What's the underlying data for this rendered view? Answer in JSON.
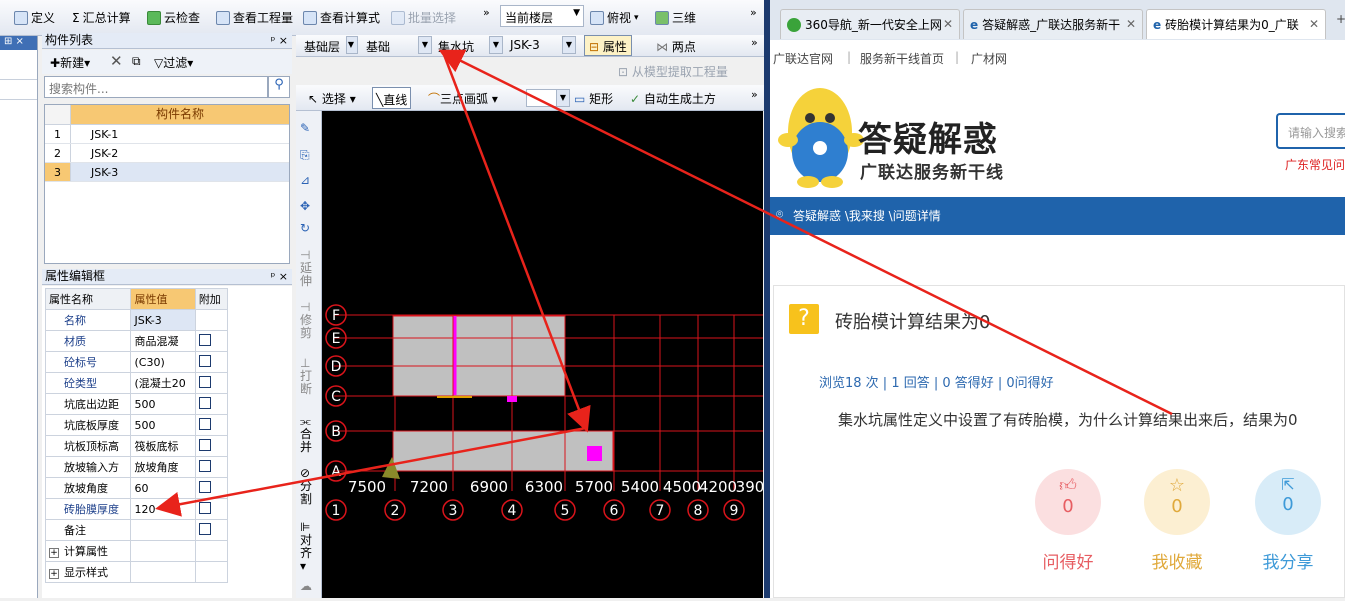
{
  "toolbar": {
    "define": "定义",
    "sum_calc": "汇总计算",
    "cloud_check": "云检查",
    "view_qty": "查看工程量",
    "view_formula": "查看计算式",
    "batch_select": "批量选择",
    "current_floor": "当前楼层",
    "top_view": "俯视",
    "three_d": "三维"
  },
  "toolbar2": {
    "layer": "基础层",
    "category": "基础",
    "type": "集水坑",
    "component": "JSK-3",
    "properties": "属性",
    "two_points": "两点",
    "extract_from_model": "从模型提取工程量"
  },
  "toolbar3": {
    "select": "选择",
    "line": "直线",
    "three_point_arc": "三点画弧",
    "rectangle": "矩形",
    "auto_earthwork": "自动生成土方"
  },
  "component_list": {
    "title": "构件列表",
    "new": "新建",
    "filter": "过滤",
    "search_placeholder": "搜索构件...",
    "col_header": "构件名称",
    "rows": [
      {
        "index": "1",
        "name": "JSK-1"
      },
      {
        "index": "2",
        "name": "JSK-2"
      },
      {
        "index": "3",
        "name": "JSK-3"
      }
    ]
  },
  "prop_editor": {
    "title": "属性编辑框",
    "headers": [
      "属性名称",
      "属性值",
      "附加"
    ],
    "rows": [
      {
        "name": "名称",
        "value": "JSK-3"
      },
      {
        "name": "材质",
        "value": "商品混凝"
      },
      {
        "name": "砼标号",
        "value": "(C30)"
      },
      {
        "name": "砼类型",
        "value": "(混凝土20"
      },
      {
        "name": "坑底出边距",
        "value": "500"
      },
      {
        "name": "坑底板厚度",
        "value": "500"
      },
      {
        "name": "坑板顶标高",
        "value": "筏板底标"
      },
      {
        "name": "放坡输入方",
        "value": "放坡角度"
      },
      {
        "name": "放坡角度",
        "value": "60"
      },
      {
        "name": "砖胎膜厚度",
        "value": "120"
      },
      {
        "name": "备注",
        "value": ""
      },
      {
        "name": "计算属性",
        "value": ""
      },
      {
        "name": "显示样式",
        "value": ""
      }
    ]
  },
  "vtools": {
    "extend": "延伸",
    "trim": "修剪",
    "break": "打断",
    "merge": "合并",
    "split": "分割",
    "align": "对齐"
  },
  "grid": {
    "row_labels": [
      "F",
      "E",
      "D",
      "C",
      "B",
      "A"
    ],
    "col_labels": [
      "1",
      "2",
      "3",
      "4",
      "5",
      "6",
      "7",
      "8",
      "9"
    ],
    "spacings": [
      "7500",
      "7200",
      "6900",
      "6300",
      "5700",
      "5400",
      "4500",
      "4200",
      "390"
    ]
  },
  "browser": {
    "tabs": [
      {
        "title": "360导航_新一代安全上网"
      },
      {
        "title": "答疑解惑_广联达服务新干"
      },
      {
        "title": "砖胎模计算结果为0_广联"
      }
    ],
    "nav_links": [
      "广联达官网",
      "服务新干线首页",
      "广材网"
    ],
    "logo_title": "答疑解惑",
    "logo_subtitle": "广联达服务新干线",
    "search_placeholder": "请输入搜索",
    "region_hint": "广东常见问",
    "breadcrumb": "答疑解惑 \\我来搜 \\问题详情",
    "question_title": "砖胎模计算结果为0",
    "stats": "浏览18 次 | 1 回答 | 0 答得好 | 0问得好",
    "question_body": "集水坑属性定义中设置了有砖胎模，为什么计算结果出来后，结果为0",
    "actions": [
      {
        "label": "问得好",
        "count": "0",
        "color": "#e75d62"
      },
      {
        "label": "我收藏",
        "count": "0",
        "color": "#e0a93b"
      },
      {
        "label": "我分享",
        "count": "0",
        "color": "#3e9ad8"
      }
    ]
  },
  "colors": {
    "accent_blue": "#1f63ab",
    "arrow_red": "#e8231b",
    "grid_red": "#d9141b"
  }
}
